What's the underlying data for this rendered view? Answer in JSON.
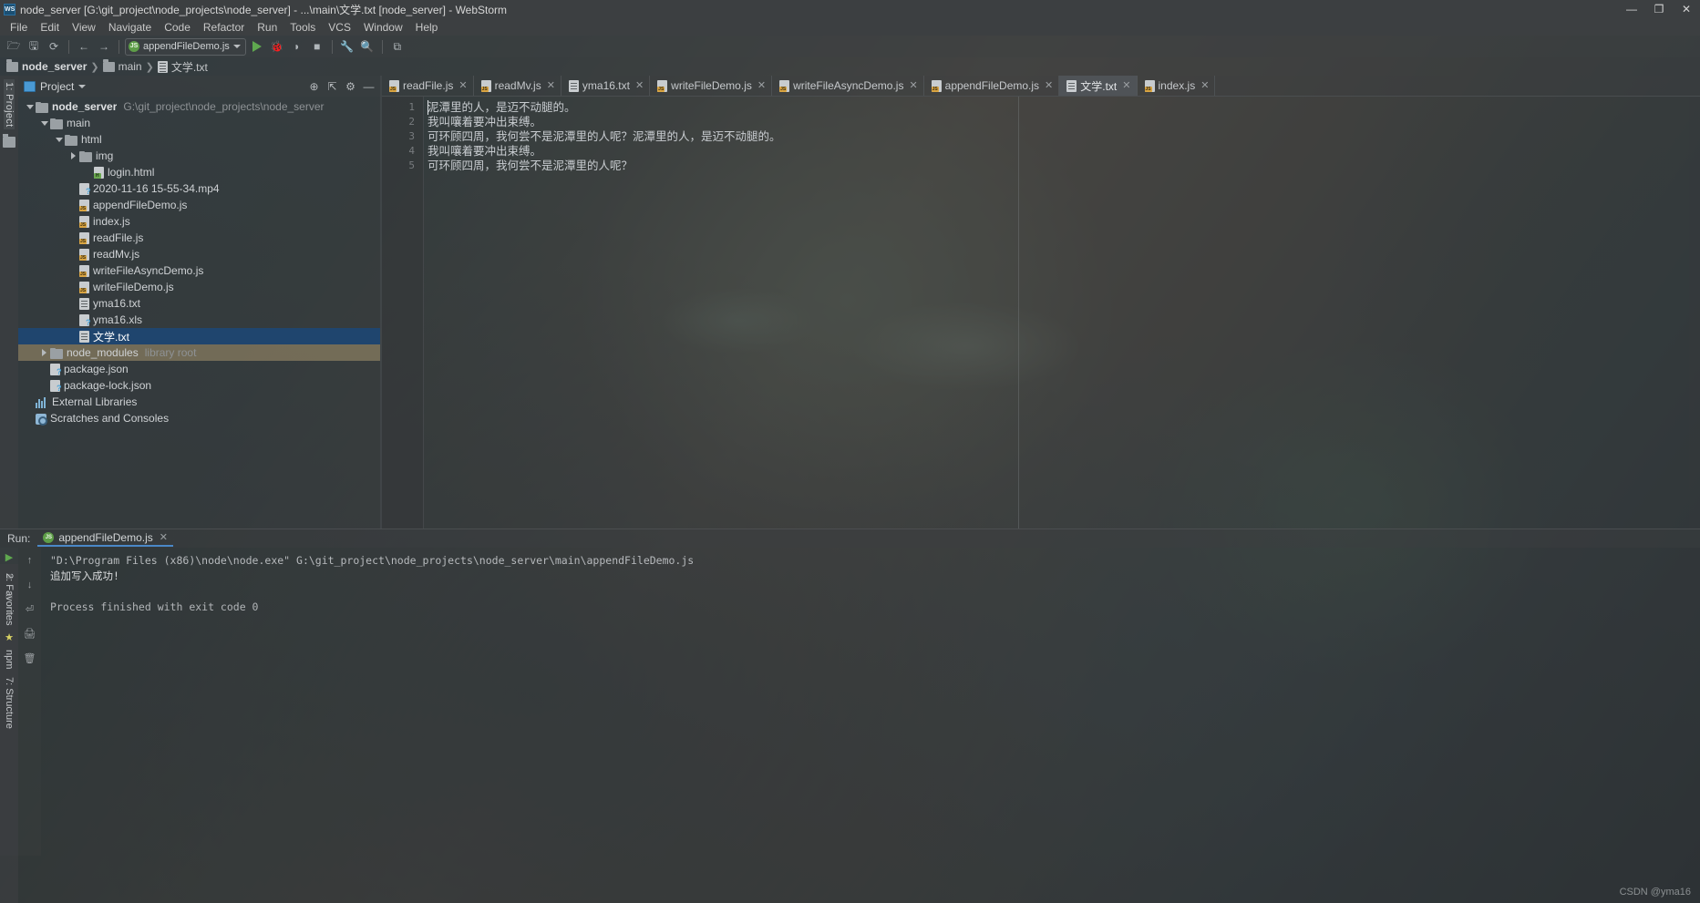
{
  "window": {
    "title": "node_server [G:\\git_project\\node_projects\\node_server] - ...\\main\\文学.txt [node_server] - WebStorm",
    "logo": "WS",
    "minimize": "—",
    "maximize": "❐",
    "close": "✕"
  },
  "menubar": {
    "items": [
      "File",
      "Edit",
      "View",
      "Navigate",
      "Code",
      "Refactor",
      "Run",
      "Tools",
      "VCS",
      "Window",
      "Help"
    ]
  },
  "toolbar": {
    "open_icon": "open-folder-icon",
    "save_icon": "save-icon",
    "sync_icon": "sync-icon",
    "back_icon": "back-arrow-icon",
    "forward_icon": "forward-arrow-icon",
    "run_config_label": "appendFileDemo.js",
    "run_config_badge": "JS",
    "run_icon": "run-icon",
    "debug_icon": "debug-icon",
    "coverage_icon": "run-with-coverage-icon",
    "stop_icon": "stop-icon",
    "settings_icon": "wrench-icon",
    "search_icon": "search-icon",
    "layout_icon": "layout-icon",
    "glyphs": {
      "open": "🗁",
      "save": "🖫",
      "sync": "⟳",
      "back": "←",
      "forward": "→",
      "debug": "🐞",
      "coverage": "◗",
      "stop": "■",
      "wrench": "🔧",
      "search": "🔍",
      "layout": "⧉"
    }
  },
  "breadcrumb": {
    "items": [
      {
        "label": "node_server",
        "icon": "folder-icon",
        "bold": true
      },
      {
        "label": "main",
        "icon": "folder-icon",
        "bold": false
      },
      {
        "label": "文学.txt",
        "icon": "text-file-icon",
        "bold": false
      }
    ],
    "separator": "❯"
  },
  "left_strip": {
    "project_label": "1: Project",
    "structure_icon": "folder-icon"
  },
  "project": {
    "header_title": "Project",
    "header_dropdown": "▾",
    "actions": [
      {
        "name": "locate-icon",
        "glyph": "⊕"
      },
      {
        "name": "collapse-all-icon",
        "glyph": "⇱"
      },
      {
        "name": "settings-gear-icon",
        "glyph": "⚙"
      },
      {
        "name": "hide-panel-icon",
        "glyph": "—"
      }
    ],
    "tree": [
      {
        "indent": 0,
        "arrow": "down",
        "icon": "folder",
        "label": "node_server",
        "bold": true,
        "hint": "G:\\git_project\\node_projects\\node_server",
        "state": "normal"
      },
      {
        "indent": 1,
        "arrow": "down",
        "icon": "folder",
        "label": "main",
        "bold": false,
        "hint": "",
        "state": "normal"
      },
      {
        "indent": 2,
        "arrow": "down",
        "icon": "folder",
        "label": "html",
        "bold": false,
        "hint": "",
        "state": "normal"
      },
      {
        "indent": 3,
        "arrow": "right",
        "icon": "folder",
        "label": "img",
        "bold": false,
        "hint": "",
        "state": "normal"
      },
      {
        "indent": 4,
        "arrow": "none",
        "icon": "html",
        "label": "login.html",
        "bold": false,
        "hint": "",
        "state": "normal"
      },
      {
        "indent": 3,
        "arrow": "none",
        "icon": "unknown",
        "label": "2020-11-16 15-55-34.mp4",
        "bold": false,
        "hint": "",
        "state": "normal"
      },
      {
        "indent": 3,
        "arrow": "none",
        "icon": "js",
        "label": "appendFileDemo.js",
        "bold": false,
        "hint": "",
        "state": "normal"
      },
      {
        "indent": 3,
        "arrow": "none",
        "icon": "js",
        "label": "index.js",
        "bold": false,
        "hint": "",
        "state": "normal"
      },
      {
        "indent": 3,
        "arrow": "none",
        "icon": "js",
        "label": "readFile.js",
        "bold": false,
        "hint": "",
        "state": "normal"
      },
      {
        "indent": 3,
        "arrow": "none",
        "icon": "js",
        "label": "readMv.js",
        "bold": false,
        "hint": "",
        "state": "normal"
      },
      {
        "indent": 3,
        "arrow": "none",
        "icon": "js",
        "label": "writeFileAsyncDemo.js",
        "bold": false,
        "hint": "",
        "state": "normal"
      },
      {
        "indent": 3,
        "arrow": "none",
        "icon": "js",
        "label": "writeFileDemo.js",
        "bold": false,
        "hint": "",
        "state": "normal"
      },
      {
        "indent": 3,
        "arrow": "none",
        "icon": "file",
        "label": "yma16.txt",
        "bold": false,
        "hint": "",
        "state": "normal"
      },
      {
        "indent": 3,
        "arrow": "none",
        "icon": "unknown",
        "label": "yma16.xls",
        "bold": false,
        "hint": "",
        "state": "normal"
      },
      {
        "indent": 3,
        "arrow": "none",
        "icon": "file",
        "label": "文学.txt",
        "bold": false,
        "hint": "",
        "state": "selected"
      },
      {
        "indent": 1,
        "arrow": "right",
        "icon": "folder",
        "label": "node_modules",
        "bold": false,
        "hint": "library root",
        "state": "libroot"
      },
      {
        "indent": 1,
        "arrow": "none",
        "icon": "unknown",
        "label": "package.json",
        "bold": false,
        "hint": "",
        "state": "normal"
      },
      {
        "indent": 1,
        "arrow": "none",
        "icon": "unknown",
        "label": "package-lock.json",
        "bold": false,
        "hint": "",
        "state": "normal"
      },
      {
        "indent": 0,
        "arrow": "none",
        "icon": "lib",
        "label": "External Libraries",
        "bold": false,
        "hint": "",
        "state": "normal"
      },
      {
        "indent": 0,
        "arrow": "none",
        "icon": "scratch",
        "label": "Scratches and Consoles",
        "bold": false,
        "hint": "",
        "state": "normal"
      }
    ]
  },
  "editor": {
    "tabs": [
      {
        "label": "readFile.js",
        "icon": "js-file-icon",
        "active": false
      },
      {
        "label": "readMv.js",
        "icon": "js-file-icon",
        "active": false
      },
      {
        "label": "yma16.txt",
        "icon": "text-file-icon",
        "active": false
      },
      {
        "label": "writeFileDemo.js",
        "icon": "js-file-icon",
        "active": false
      },
      {
        "label": "writeFileAsyncDemo.js",
        "icon": "js-file-icon",
        "active": false
      },
      {
        "label": "appendFileDemo.js",
        "icon": "js-file-icon",
        "active": false
      },
      {
        "label": "文学.txt",
        "icon": "text-file-icon",
        "active": true
      },
      {
        "label": "index.js",
        "icon": "js-file-icon",
        "active": false
      }
    ],
    "close_glyph": "✕",
    "line_numbers": [
      "1",
      "2",
      "3",
      "4",
      "5"
    ],
    "lines": [
      "泥潭里的人，是迈不动腿的。",
      "我叫嚷着要冲出束缚。",
      "可环顾四周，我何尝不是泥潭里的人呢？泥潭里的人，是迈不动腿的。",
      "我叫嚷着要冲出束缚。",
      "可环顾四周，我何尝不是泥潭里的人呢？"
    ]
  },
  "run_panel": {
    "label": "Run:",
    "tab_label": "appendFileDemo.js",
    "tab_badge": "JS",
    "tab_close": "✕",
    "side_icons": [
      {
        "name": "rerun-icon",
        "glyph": "▶"
      },
      {
        "name": "stop-icon",
        "glyph": "■"
      },
      {
        "name": "pin-icon",
        "glyph": "⊞"
      },
      {
        "name": "close-icon",
        "glyph": "✕"
      }
    ],
    "gutter_icons": [
      {
        "name": "scroll-up-icon",
        "glyph": "↑"
      },
      {
        "name": "scroll-down-icon",
        "glyph": "↓"
      },
      {
        "name": "soft-wrap-icon",
        "glyph": "⏎"
      },
      {
        "name": "print-icon",
        "glyph": "🖨"
      },
      {
        "name": "clear-all-icon",
        "glyph": "🗑"
      }
    ],
    "console_lines": [
      {
        "type": "cmd",
        "text": "\"D:\\Program Files (x86)\\node\\node.exe\" G:\\git_project\\node_projects\\node_server\\main\\appendFileDemo.js"
      },
      {
        "type": "out",
        "text": "追加写入成功!"
      },
      {
        "type": "blank",
        "text": ""
      },
      {
        "type": "sys",
        "text": "Process finished with exit code 0"
      }
    ]
  },
  "left_dock": {
    "favorites_label": "2: Favorites",
    "star_glyph": "★",
    "npm_label": "npm",
    "structure_label": "7: Structure"
  },
  "watermark": "CSDN @yma16",
  "colors": {
    "accent": "#4a88c7",
    "selection": "#1f456e",
    "library_root": "#a5946e",
    "js_badge": "#d9a441",
    "run_green": "#5fa84f"
  }
}
